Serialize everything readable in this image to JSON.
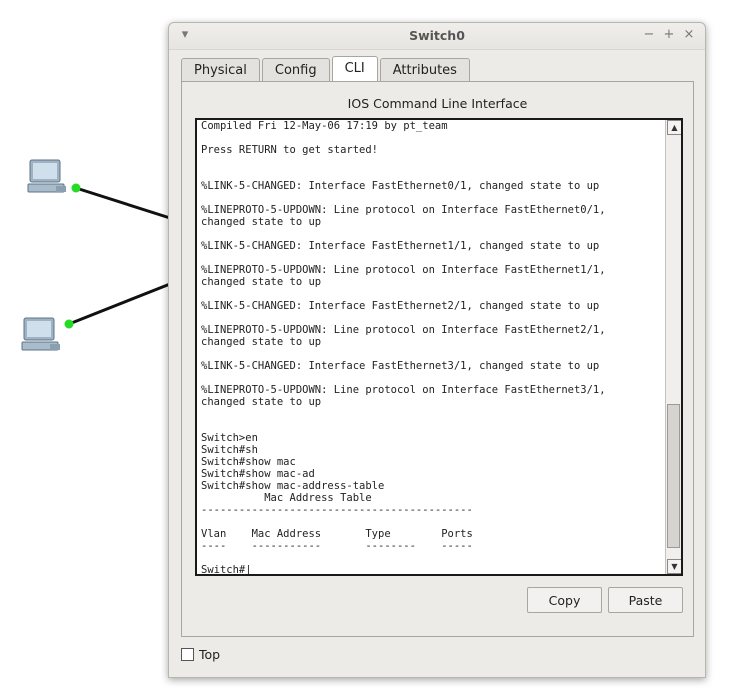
{
  "window": {
    "title": "Switch0"
  },
  "titlebar_buttons": {
    "menu": "▾",
    "minimize": "−",
    "maximize": "+",
    "close": "×"
  },
  "tabs": [
    {
      "label": "Physical",
      "active": false
    },
    {
      "label": "Config",
      "active": false
    },
    {
      "label": "CLI",
      "active": true
    },
    {
      "label": "Attributes",
      "active": false
    }
  ],
  "panel": {
    "title": "IOS Command Line Interface"
  },
  "terminal": {
    "text": "Compiled Fri 12-May-06 17:19 by pt_team\n\nPress RETURN to get started!\n\n\n%LINK-5-CHANGED: Interface FastEthernet0/1, changed state to up\n\n%LINEPROTO-5-UPDOWN: Line protocol on Interface FastEthernet0/1,\nchanged state to up\n\n%LINK-5-CHANGED: Interface FastEthernet1/1, changed state to up\n\n%LINEPROTO-5-UPDOWN: Line protocol on Interface FastEthernet1/1,\nchanged state to up\n\n%LINK-5-CHANGED: Interface FastEthernet2/1, changed state to up\n\n%LINEPROTO-5-UPDOWN: Line protocol on Interface FastEthernet2/1,\nchanged state to up\n\n%LINK-5-CHANGED: Interface FastEthernet3/1, changed state to up\n\n%LINEPROTO-5-UPDOWN: Line protocol on Interface FastEthernet3/1,\nchanged state to up\n\n\nSwitch>en\nSwitch#sh\nSwitch#show mac\nSwitch#show mac-ad\nSwitch#show mac-address-table\n          Mac Address Table\n-------------------------------------------\n\nVlan    Mac Address       Type        Ports\n----    -----------       --------    -----\n\nSwitch#"
  },
  "buttons": {
    "copy": "Copy",
    "paste": "Paste"
  },
  "top_checkbox": {
    "label": "Top",
    "checked": false
  },
  "colors": {
    "link": "#111111",
    "port_up": "#22dd22",
    "terminal_border": "#1a1a1a"
  }
}
